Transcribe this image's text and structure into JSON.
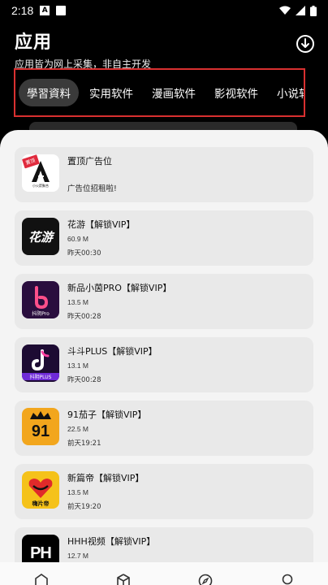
{
  "status_bar": {
    "time": "2:18"
  },
  "header": {
    "title": "应用",
    "subtitle": "应用皆为网上采集，非自主开发"
  },
  "tabs": [
    {
      "label": "學習資料"
    },
    {
      "label": "实用软件"
    },
    {
      "label": "漫画软件"
    },
    {
      "label": "影视软件"
    },
    {
      "label": "小说软件"
    }
  ],
  "ad": {
    "name": "置顶广告位",
    "text": "广告位招租啦!",
    "badge": "置顶",
    "logo_caption": "小火箭聚合"
  },
  "apps": [
    {
      "name": "花游【解锁VIP】",
      "size": "60.9 M",
      "date": "昨天00:30",
      "icon_text": "花游",
      "icon_bg": "#111111"
    },
    {
      "name": "新品小茵PRO【解锁VIP】",
      "size": "13.5 M",
      "date": "昨天00:28",
      "icon_text": "抖阴Pro",
      "icon_bg": "#2a0e3e"
    },
    {
      "name": "斗斗PLUS【解锁VIP】",
      "size": "13.1 M",
      "date": "昨天00:28",
      "icon_text": "抖阴PLUS",
      "icon_bg": "#1d0b33"
    },
    {
      "name": "91茄子【解锁VIP】",
      "size": "22.5 M",
      "date": "前天19:21",
      "icon_text": "91",
      "icon_bg": "#f2a61d"
    },
    {
      "name": "新篇帝【解锁VIP】",
      "size": "13.5 M",
      "date": "前天19:20",
      "icon_text": "嗨片帝",
      "icon_bg": "#f5c21a"
    },
    {
      "name": "HHH视频【解锁VIP】",
      "size": "12.7 M",
      "date": "",
      "icon_text": "PH",
      "icon_bg": "#000000"
    }
  ],
  "colors": {
    "accent_border": "#d93030",
    "active_tab": "#3a3a3a",
    "card_bg": "#e9e9e9",
    "sheet_bg": "#f4f4f4"
  },
  "bottom_nav": [
    {
      "icon": "home-icon"
    },
    {
      "icon": "cube-icon"
    },
    {
      "icon": "compass-icon"
    },
    {
      "icon": "profile-icon"
    }
  ]
}
